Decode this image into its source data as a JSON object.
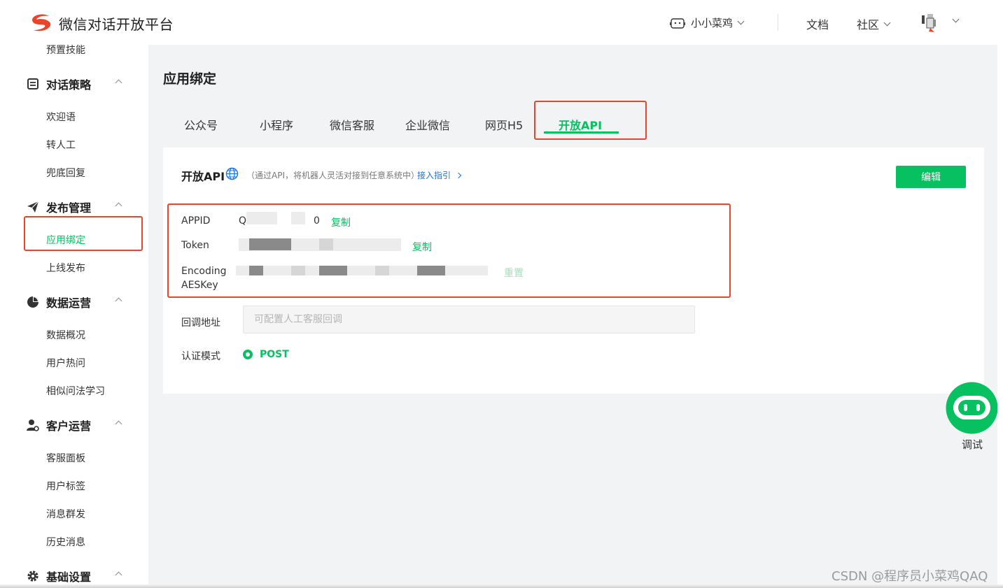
{
  "header": {
    "brand": "微信对话开放平台",
    "bot_name": "小小菜鸡",
    "docs": "文档",
    "community": "社区"
  },
  "sidebar": {
    "top_item": "预置技能",
    "groups": [
      {
        "title": "对话策略",
        "items": [
          "欢迎语",
          "转人工",
          "兜底回复"
        ]
      },
      {
        "title": "发布管理",
        "items": [
          "应用绑定",
          "上线发布"
        ]
      },
      {
        "title": "数据运营",
        "items": [
          "数据概况",
          "用户热问",
          "相似问法学习"
        ]
      },
      {
        "title": "客户运营",
        "items": [
          "客服面板",
          "用户标签",
          "消息群发",
          "历史消息"
        ]
      },
      {
        "title": "基础设置",
        "items": []
      }
    ]
  },
  "main": {
    "title": "应用绑定",
    "tabs": [
      "公众号",
      "小程序",
      "微信客服",
      "企业微信",
      "网页H5",
      "开放API"
    ],
    "active_tab": "开放API",
    "card": {
      "title": "开放API",
      "desc": "（通过API，将机器人灵活对接到任意系统中）",
      "guide_link": "接入指引",
      "edit": "编辑",
      "fields": {
        "appid_label": "APPID",
        "appid_value_start": "Q",
        "appid_value_end": "0",
        "token_label": "Token",
        "aes_label_1": "Encoding",
        "aes_label_2": "AESKey",
        "copy": "复制",
        "reset": "重置",
        "callback_label": "回调地址",
        "callback_placeholder": "可配置人工客服回调",
        "auth_label": "认证模式",
        "auth_value": "POST"
      }
    }
  },
  "debug": {
    "label": "调试"
  },
  "watermark": "CSDN @程序员小菜鸡QAQ",
  "colors": {
    "accent": "#07c160",
    "highlight_box": "#e8452c",
    "link": "#1a73e8"
  }
}
